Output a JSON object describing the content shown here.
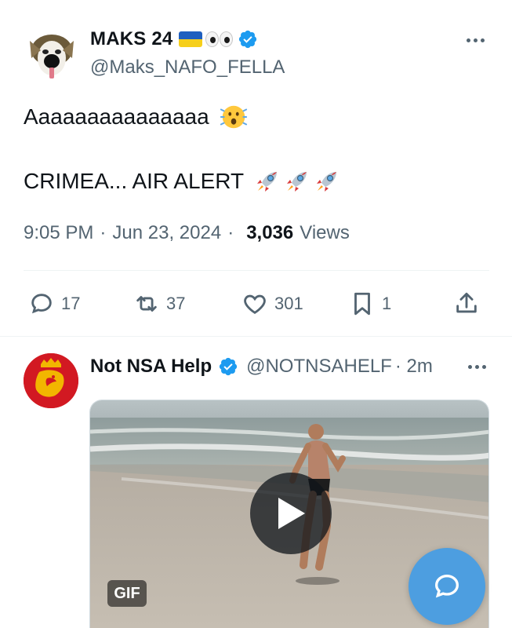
{
  "main_post": {
    "author": {
      "display_name": "MAKS 24",
      "handle": "@Maks_NAFO_FELLA",
      "verified": true,
      "name_emojis": [
        "ukraine-flag-icon",
        "eyes-icon"
      ]
    },
    "text_line1": "Aaaaaaaaaaaaaaa",
    "text_line1_emoji": "face-with-open-mouth-icon",
    "text_line2": "CRIMEA... AIR ALERT",
    "text_line2_emojis": [
      "rocket-icon",
      "rocket-icon",
      "rocket-icon"
    ],
    "time": "9:05 PM",
    "date": "Jun 23, 2024",
    "views_count": "3,036",
    "views_label": "Views",
    "actions": {
      "replies": "17",
      "reposts": "37",
      "likes": "301",
      "bookmarks": "1"
    }
  },
  "reply_post": {
    "author": {
      "display_name": "Not NSA Help",
      "handle": "@NOTNSAHELF",
      "verified": true
    },
    "time": "· 2m",
    "media": {
      "type": "gif",
      "badge": "GIF"
    }
  },
  "colors": {
    "accent": "#1d9bf0",
    "fab": "#4d9ee0",
    "muted_text": "#536471",
    "primary_text": "#0f1419"
  }
}
